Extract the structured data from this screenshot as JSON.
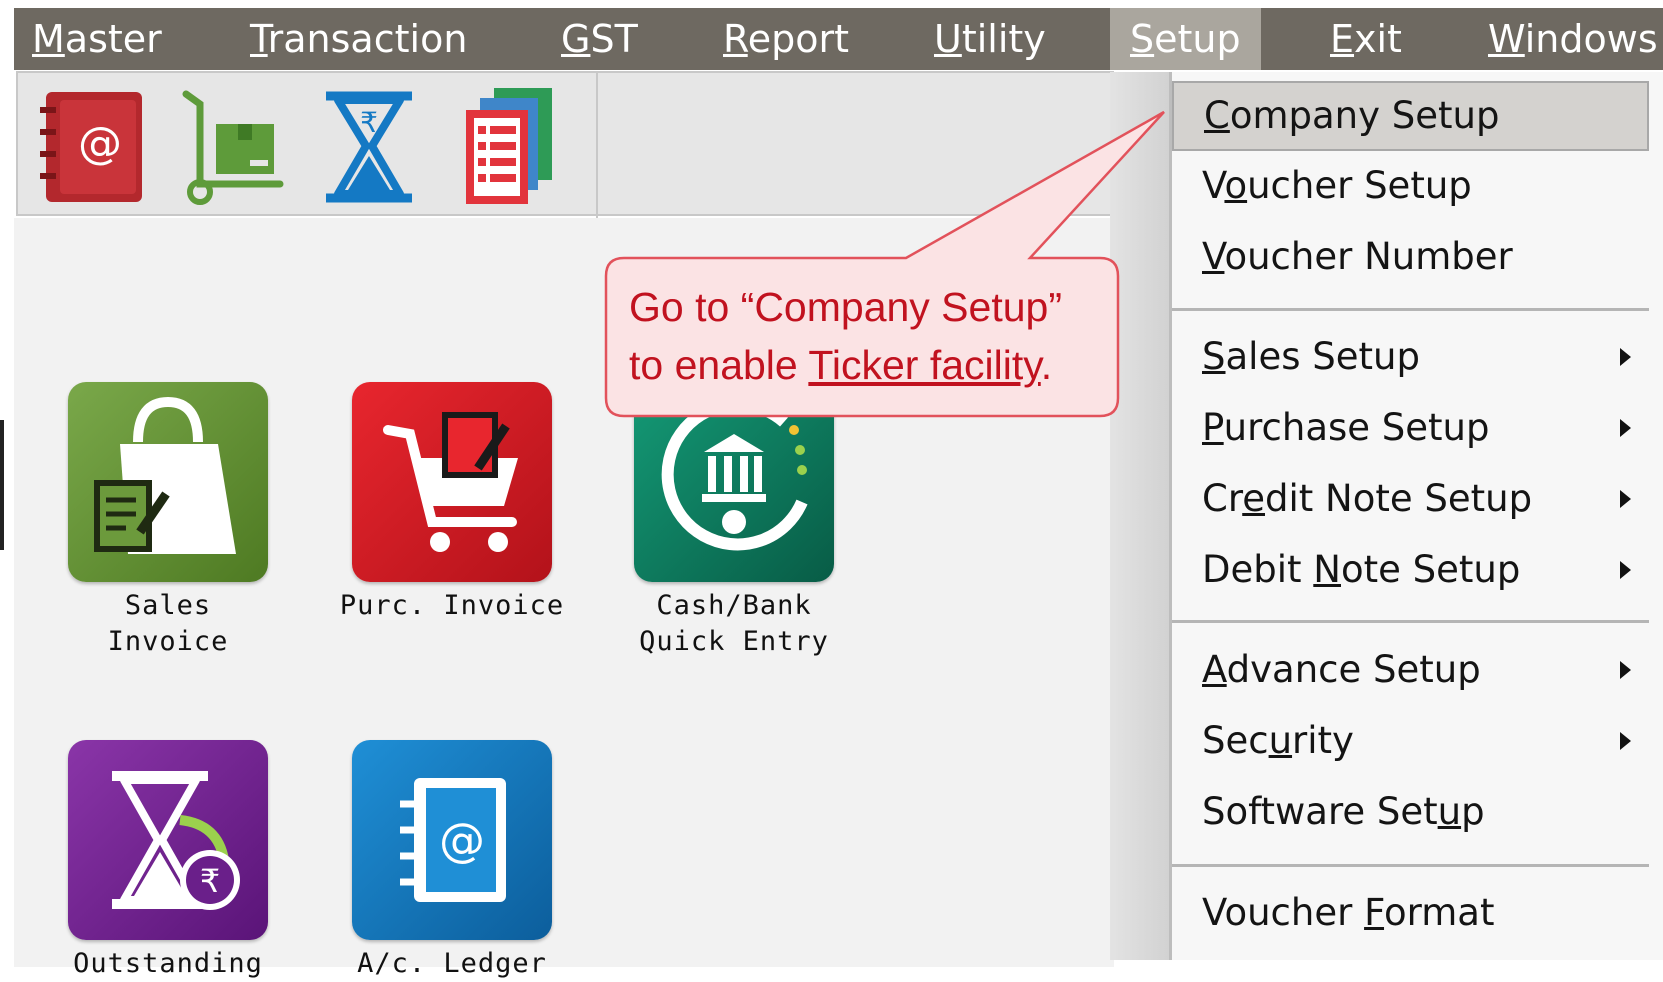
{
  "menubar": {
    "items": [
      {
        "pre": "",
        "ul": "M",
        "post": "aster"
      },
      {
        "pre": "",
        "ul": "T",
        "post": "ransaction"
      },
      {
        "pre": "",
        "ul": "G",
        "post": "ST"
      },
      {
        "pre": "",
        "ul": "R",
        "post": "eport"
      },
      {
        "pre": "",
        "ul": "U",
        "post": "tility"
      },
      {
        "pre": "",
        "ul": "S",
        "post": "etup"
      },
      {
        "pre": "",
        "ul": "E",
        "post": "xit"
      },
      {
        "pre": "",
        "ul": "W",
        "post": "indows"
      }
    ],
    "active": "Setup"
  },
  "toolbar": {
    "icons": [
      "address-book-icon",
      "trolley-icon",
      "hourglass-rupee-icon",
      "reports-icon"
    ]
  },
  "tiles": [
    {
      "label_line1": "Sales",
      "label_line2": "Invoice",
      "icon": "shopping-bag-icon",
      "color": "#5e8c2e"
    },
    {
      "label_line1": "Purc. Invoice",
      "label_line2": "",
      "icon": "shopping-cart-icon",
      "color": "#cc1b24"
    },
    {
      "label_line1": "Cash/Bank",
      "label_line2": "Quick Entry",
      "icon": "bank-icon",
      "color": "#0b7a5e"
    },
    {
      "label_line1": "Outstanding",
      "label_line2": "",
      "icon": "hourglass-rupee-icon",
      "color": "#6a1f8a"
    },
    {
      "label_line1": "A/c. Ledger",
      "label_line2": "",
      "icon": "address-book-icon",
      "color": "#1177c2"
    }
  ],
  "dropdown": {
    "items": [
      {
        "pre": "",
        "ul": "C",
        "post": "ompany Setup",
        "submenu": false
      },
      {
        "pre": "V",
        "ul": "o",
        "post": "ucher Setup",
        "submenu": false
      },
      {
        "pre": "",
        "ul": "V",
        "post": "oucher Number",
        "submenu": false
      },
      {
        "pre": "",
        "ul": "S",
        "post": "ales Setup",
        "submenu": true
      },
      {
        "pre": "",
        "ul": "P",
        "post": "urchase Setup",
        "submenu": true
      },
      {
        "pre": "Cr",
        "ul": "e",
        "post": "dit Note Setup",
        "submenu": true
      },
      {
        "pre": "Debit ",
        "ul": "N",
        "post": "ote Setup",
        "submenu": true
      },
      {
        "pre": "",
        "ul": "A",
        "post": "dvance Setup",
        "submenu": true
      },
      {
        "pre": "Sec",
        "ul": "u",
        "post": "rity",
        "submenu": true
      },
      {
        "pre": "Software Set",
        "ul": "u",
        "post": "p",
        "submenu": false
      },
      {
        "pre": "Voucher ",
        "ul": "F",
        "post": "ormat",
        "submenu": false
      }
    ]
  },
  "callout": {
    "line1": "Go to “Company Setup”",
    "line2_pre": "to enable ",
    "line2_link": "Ticker facility",
    "line2_post": "."
  },
  "colors": {
    "menubar": "#6e6961",
    "callout_text": "#c1121f",
    "callout_fill": "#fbe3e4",
    "callout_border": "#e2525b"
  }
}
